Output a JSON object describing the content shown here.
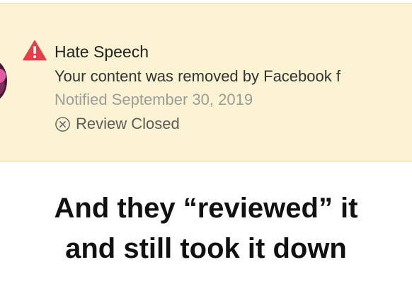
{
  "notification": {
    "category": "Hate Speech",
    "message": "Your content was removed by Facebook f",
    "notified": "Notified September 30, 2019",
    "review_status": "Review Closed",
    "warning_icon": "warning-triangle-icon",
    "review_icon": "circle-x-icon",
    "accent_color": "#e53e48",
    "background_color": "#fbf3d1"
  },
  "caption": {
    "line_1": "And they “reviewed” it",
    "line_2": "and still took it down"
  }
}
